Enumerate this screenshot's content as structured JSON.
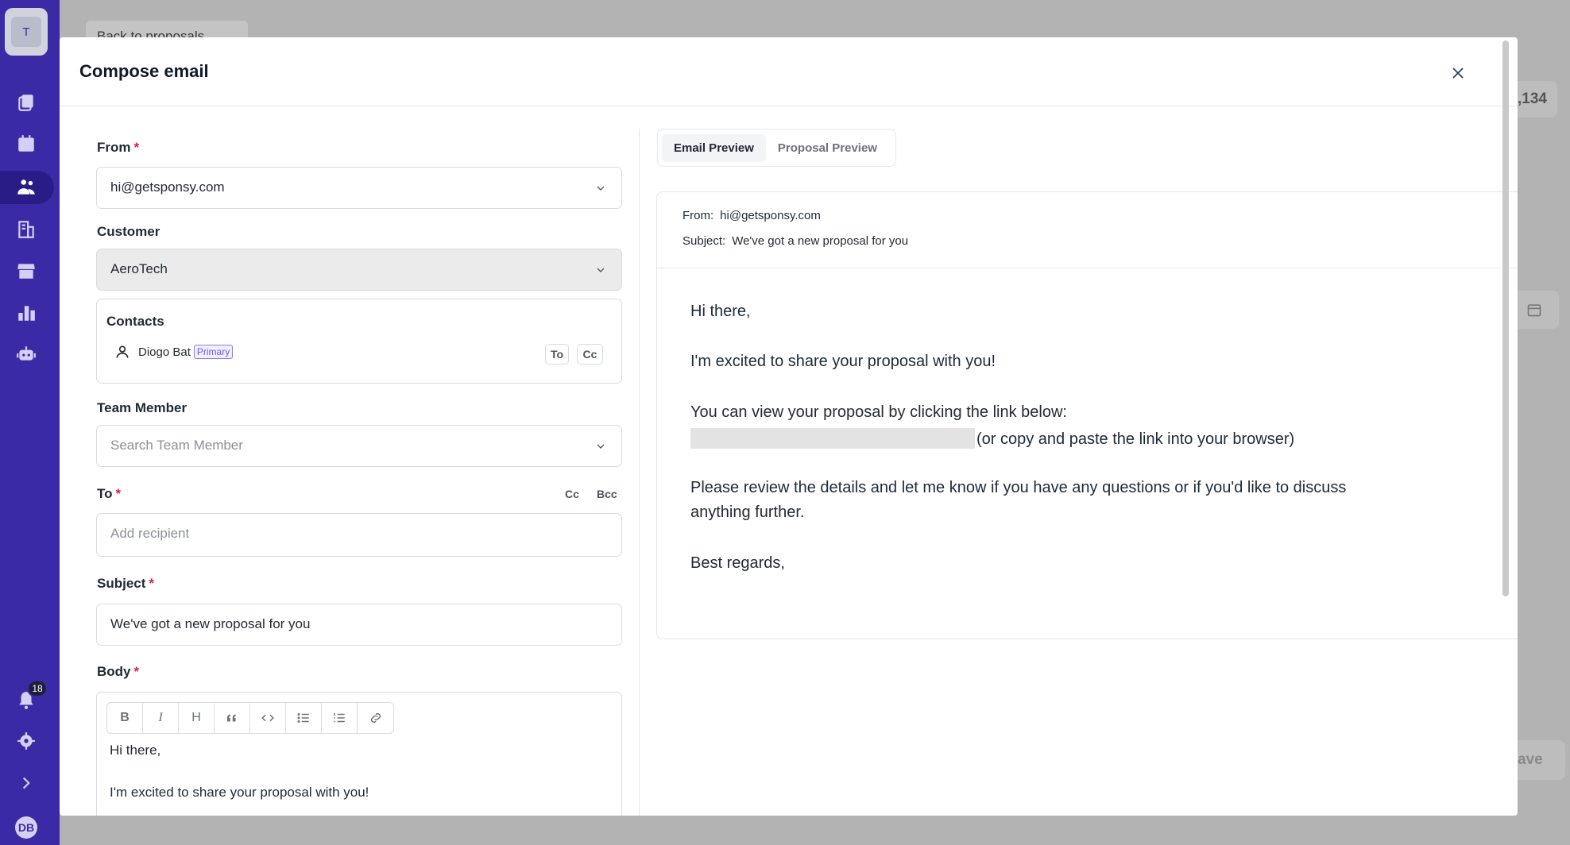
{
  "sidebar": {
    "workspace_initial": "T",
    "notifications_count": "18",
    "user_initials": "DB"
  },
  "background": {
    "back_label": "Back to proposals",
    "partial_number": ",134",
    "partial_save": "ave"
  },
  "modal": {
    "title": "Compose email"
  },
  "form": {
    "from_label": "From",
    "from_value": "hi@getsponsy.com",
    "customer_label": "Customer",
    "customer_value": "AeroTech",
    "contacts_label": "Contacts",
    "contact_name": "Diogo Bat",
    "contact_badge": "Primary",
    "contact_to": "To",
    "contact_cc": "Cc",
    "team_label": "Team Member",
    "team_placeholder": "Search Team Member",
    "to_label": "To",
    "cc_label": "Cc",
    "bcc_label": "Bcc",
    "to_placeholder": "Add recipient",
    "subject_label": "Subject",
    "subject_value": "We've got a new proposal for you",
    "body_label": "Body",
    "body_lines": [
      "Hi there,",
      "I'm excited to share your proposal with you!"
    ],
    "required_mark": "*"
  },
  "toolbar": {
    "bold": "B",
    "italic": "I",
    "heading": "H"
  },
  "preview": {
    "tabs": [
      "Email Preview",
      "Proposal Preview"
    ],
    "from_label": "From:",
    "from_value": "hi@getsponsy.com",
    "subject_label": "Subject:",
    "subject_value": "We've got a new proposal for you",
    "greeting": "Hi there,",
    "line1": "I'm excited to share your proposal with you!",
    "line2": "You can view your proposal by clicking the link below:",
    "link_suffix": "(or copy and paste the link into your browser)",
    "line3a": "Please review the details and let me know if you have any questions or if you'd like to discuss",
    "line3b": "anything further.",
    "closing": "Best regards,"
  }
}
